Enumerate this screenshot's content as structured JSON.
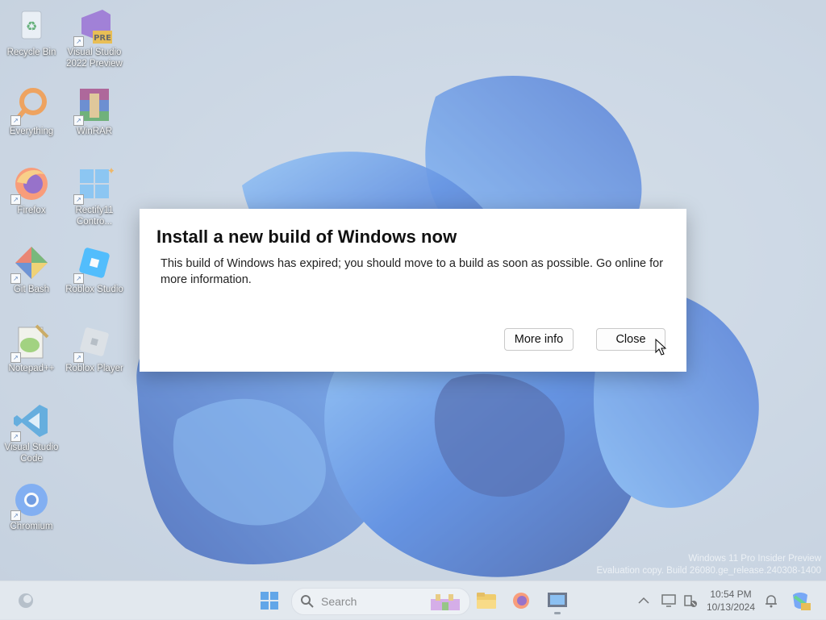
{
  "desktop_icons": [
    {
      "id": "recycle-bin",
      "label": "Recycle Bin"
    },
    {
      "id": "visual-studio-2022-preview",
      "label": "Visual Studio 2022 Preview",
      "badge": "PRE"
    },
    {
      "id": "everything",
      "label": "Everything"
    },
    {
      "id": "winrar",
      "label": "WinRAR"
    },
    {
      "id": "firefox",
      "label": "Firefox"
    },
    {
      "id": "rectify11",
      "label": "Rectify11 Contro..."
    },
    {
      "id": "git-bash",
      "label": "Git Bash"
    },
    {
      "id": "roblox-studio",
      "label": "Roblox Studio"
    },
    {
      "id": "notepad-plus-plus",
      "label": "Notepad++"
    },
    {
      "id": "roblox-player",
      "label": "Roblox Player"
    },
    {
      "id": "vscode",
      "label": "Visual Studio Code"
    },
    {
      "id": "chromium",
      "label": "Chromium"
    }
  ],
  "dialog": {
    "title": "Install a new build of Windows now",
    "message": "This build of Windows has expired; you should move to a build as soon as possible. Go online for more information.",
    "more_info_label": "More info",
    "close_label": "Close"
  },
  "watermark": {
    "line1": "Windows 11 Pro Insider Preview",
    "line2": "Evaluation copy. Build 26080.ge_release.240308-1400"
  },
  "taskbar": {
    "search_placeholder": "Search",
    "time": "10:54 PM",
    "date": "10/13/2024",
    "icons": [
      "widgets-icon",
      "start-icon",
      "search-icon",
      "file-explorer-icon",
      "firefox-icon",
      "active-app-icon",
      "show-hidden-icons-icon",
      "network-icon",
      "battery-icon",
      "notification-icon",
      "copilot-icon"
    ]
  },
  "colors": {
    "accent": "#0067c0",
    "bloom_dark": "#0a3aa8",
    "bloom_light": "#3f8ff0"
  }
}
